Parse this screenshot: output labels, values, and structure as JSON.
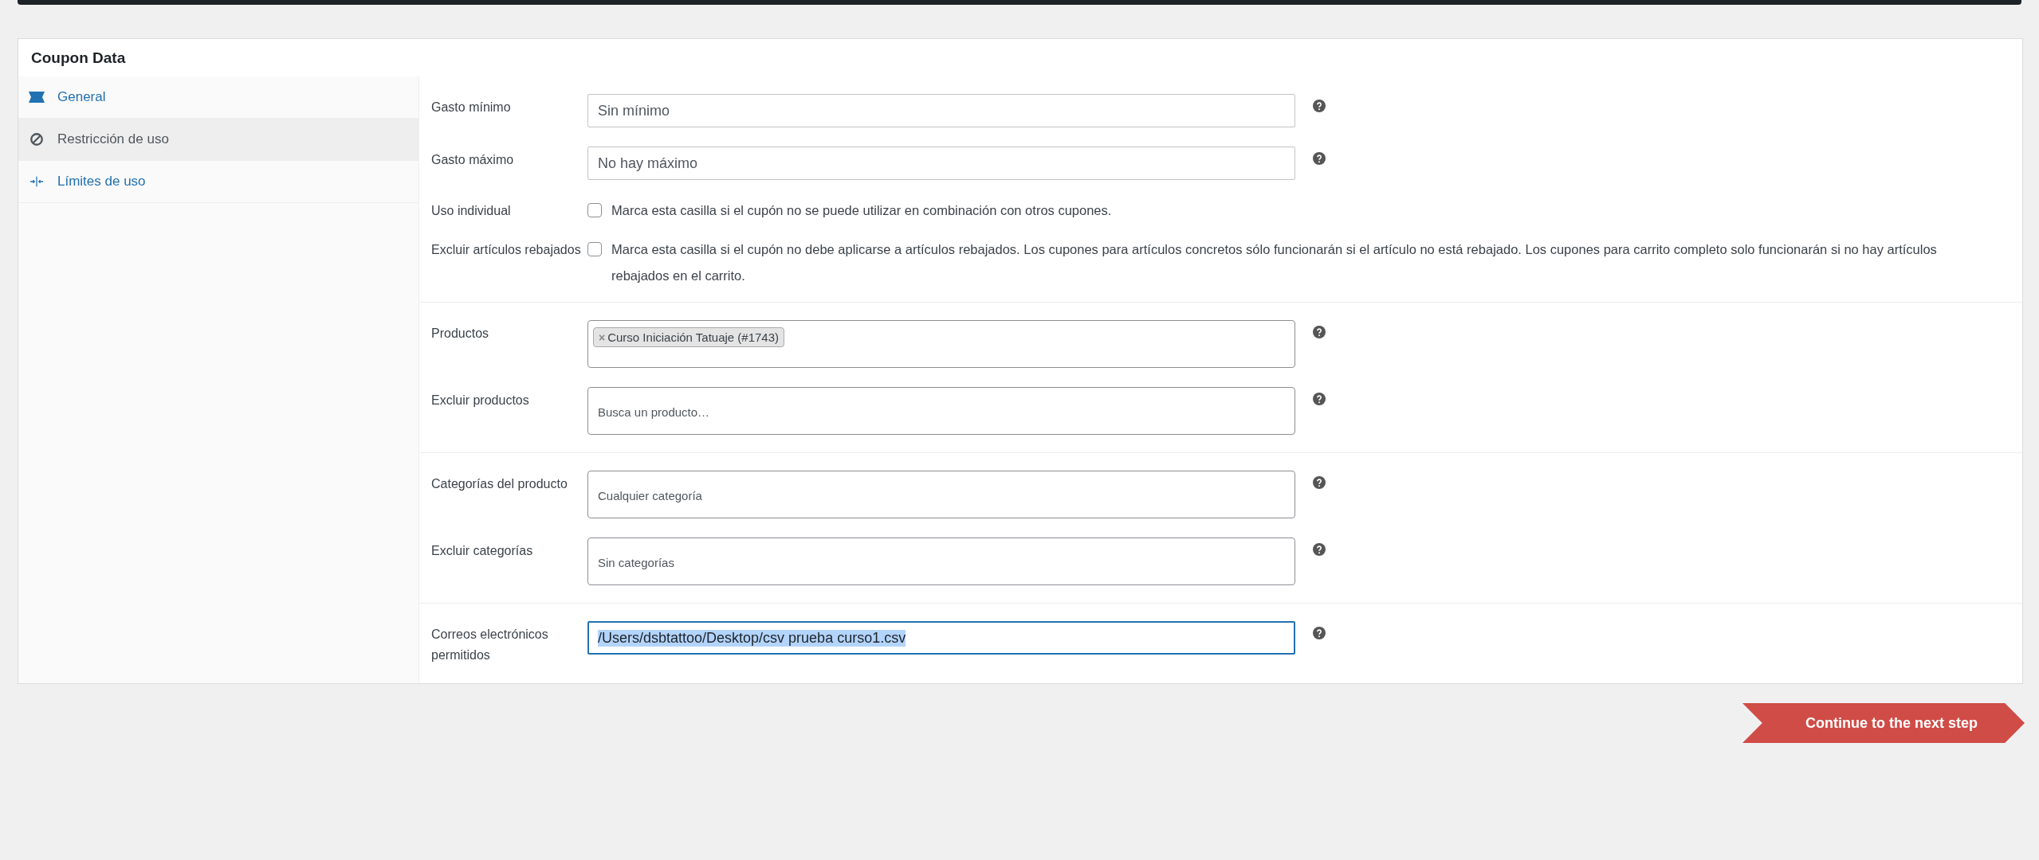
{
  "panel": {
    "title": "Coupon Data"
  },
  "tabs": [
    {
      "label": "General",
      "selected": false
    },
    {
      "label": "Restricción de uso",
      "selected": true
    },
    {
      "label": "Límites de uso",
      "selected": false
    }
  ],
  "sections": [
    {
      "fields": [
        {
          "kind": "text",
          "label": "Gasto mínimo",
          "placeholder": "Sin mínimo"
        },
        {
          "kind": "text",
          "label": "Gasto máximo",
          "placeholder": "No hay máximo"
        },
        {
          "kind": "checkbox",
          "label": "Uso individual",
          "checked": false,
          "description": "Marca esta casilla si el cupón no se puede utilizar en combinación con otros cupones."
        },
        {
          "kind": "checkbox",
          "label": "Excluir artículos rebajados",
          "checked": false,
          "description": "Marca esta casilla si el cupón no debe aplicarse a artículos rebajados. Los cupones para artículos concretos sólo funcionarán si el artículo no está rebajado. Los cupones para carrito completo solo funcionarán si no hay artículos rebajados en el carrito."
        }
      ]
    },
    {
      "fields": [
        {
          "kind": "select",
          "label": "Productos",
          "chips": [
            {
              "remove": "×",
              "label": "Curso Iniciación Tatuaje (#1743)"
            }
          ]
        },
        {
          "kind": "select",
          "label": "Excluir productos",
          "placeholder": "Busca un producto…"
        }
      ]
    },
    {
      "fields": [
        {
          "kind": "select",
          "label": "Categorías del producto",
          "placeholder": "Cualquier categoría"
        },
        {
          "kind": "select",
          "label": "Excluir categorías",
          "placeholder": "Sin categorías"
        }
      ]
    },
    {
      "fields": [
        {
          "kind": "text",
          "label": "Correos electrónicos permitidos",
          "value": "/Users/dsbtattoo/Desktop/csv prueba curso1.csv",
          "focused": true
        }
      ]
    }
  ],
  "next_button": {
    "label": "Continue to the next step"
  }
}
